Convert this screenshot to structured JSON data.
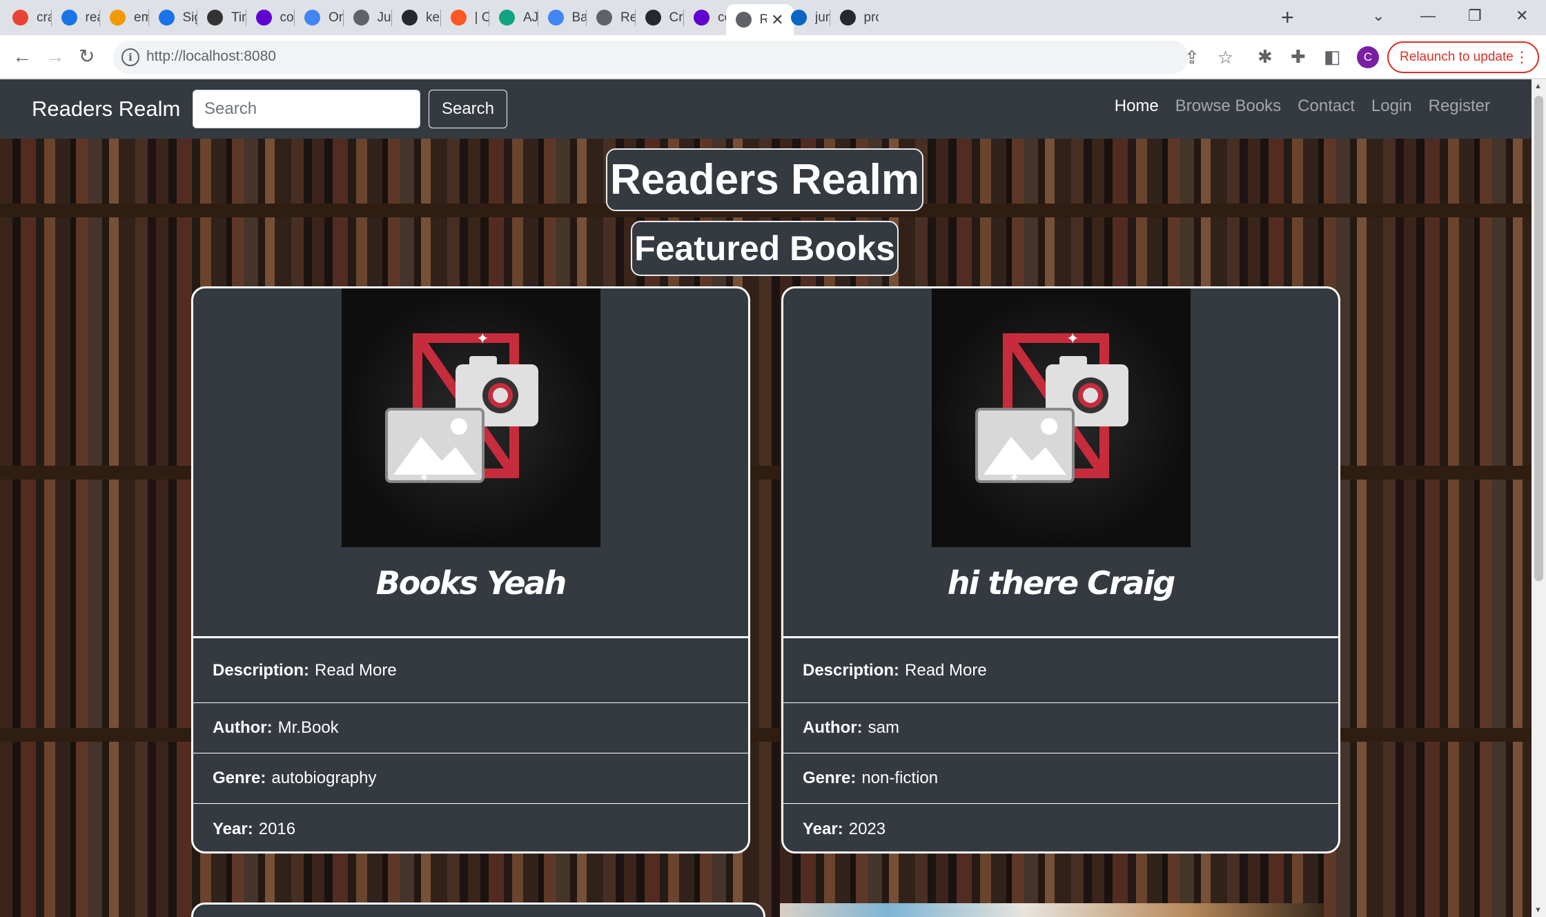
{
  "browser": {
    "tabs": [
      {
        "label": "craig",
        "icon": "google-icon",
        "color": "#ea4335"
      },
      {
        "label": "reade",
        "icon": "bookmark-icon",
        "color": "#1a73e8"
      },
      {
        "label": "email",
        "icon": "bookmark-icon",
        "color": "#f29900"
      },
      {
        "label": "Sign",
        "icon": "bookmark-icon",
        "color": "#1a73e8"
      },
      {
        "label": "TinyP",
        "icon": "panda-icon",
        "color": "#333333"
      },
      {
        "label": "conv",
        "icon": "yahoo-icon",
        "color": "#6001d2"
      },
      {
        "label": "Onlin",
        "icon": "globe-icon",
        "color": "#4285f4"
      },
      {
        "label": "Just a",
        "icon": "globe-icon",
        "color": "#5f6368"
      },
      {
        "label": "kera",
        "icon": "github-icon",
        "color": "#24292f"
      },
      {
        "label": "| Cod",
        "icon": "record-icon",
        "color": "#ff5722"
      },
      {
        "label": "AJAX",
        "icon": "chatgpt-icon",
        "color": "#10a37f"
      },
      {
        "label": "Bard",
        "icon": "sparkle-icon",
        "color": "#4285f4"
      },
      {
        "label": "Read",
        "icon": "globe-icon",
        "color": "#5f6368"
      },
      {
        "label": "Craig",
        "icon": "github-icon",
        "color": "#24292f"
      },
      {
        "label": "codir",
        "icon": "yahoo-icon",
        "color": "#6001d2"
      },
      {
        "label": "R",
        "icon": "globe-icon",
        "color": "#5f6368"
      },
      {
        "label": "junio",
        "icon": "linkedin-icon",
        "color": "#0a66c2"
      },
      {
        "label": "proje",
        "icon": "github-icon",
        "color": "#24292f"
      }
    ],
    "url": "http://localhost:8080",
    "relaunch_label": "Relaunch to update",
    "avatar_letter": "C"
  },
  "navbar": {
    "brand": "Readers Realm",
    "search_placeholder": "Search",
    "search_button": "Search",
    "links": [
      "Home",
      "Browse Books",
      "Contact",
      "Login",
      "Register"
    ]
  },
  "hero": {
    "title": "Readers Realm",
    "featured_heading": "Featured Books"
  },
  "books": [
    {
      "title": "Books Yeah",
      "description_label": "Description:",
      "description_link": "Read More",
      "author_label": "Author:",
      "author": "Mr.Book",
      "genre_label": "Genre:",
      "genre": "autobiography",
      "year_label": "Year:",
      "year": "2016"
    },
    {
      "title": "hi there Craig",
      "description_label": "Description:",
      "description_link": "Read More",
      "author_label": "Author:",
      "author": "sam",
      "genre_label": "Genre:",
      "genre": "non-fiction",
      "year_label": "Year:",
      "year": "2023"
    }
  ]
}
